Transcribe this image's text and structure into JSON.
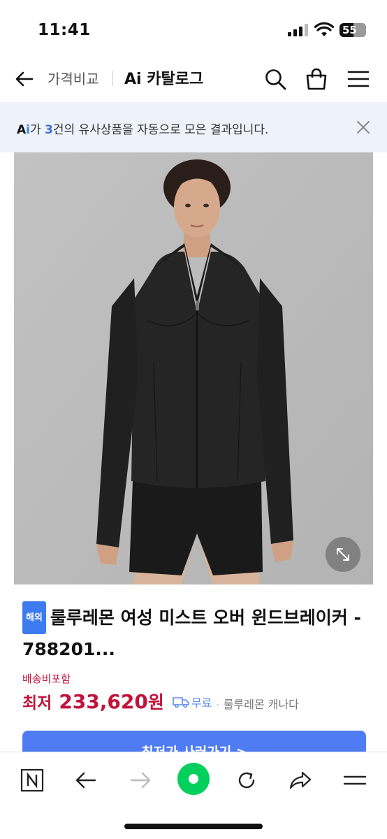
{
  "status_bar": {
    "time": "11:41",
    "battery": "55"
  },
  "header": {
    "crumb": "가격비교",
    "title": "Ai 카탈로그"
  },
  "banner": {
    "ai_a": "A",
    "ai_i": "i",
    "text_before": "가 ",
    "count": "3",
    "text_after": "건의 유사상품을 자동으로 모은 결과입니다."
  },
  "product": {
    "badge": "해외",
    "name": "룰루레몬 여성 미스트 오버 윈드브레이커 - 788201...",
    "shipping": "배송비포함",
    "price_label": "최저",
    "price": "233,620",
    "currency": "원",
    "free_shipping": "무료",
    "separator": "·",
    "shop": "룰루레몬 캐나다"
  },
  "buy_button": "최저가 사러가기 >",
  "colors": {
    "accent": "#4f7cf3",
    "price": "#c0143c",
    "banner_bg": "#eef2fa"
  }
}
